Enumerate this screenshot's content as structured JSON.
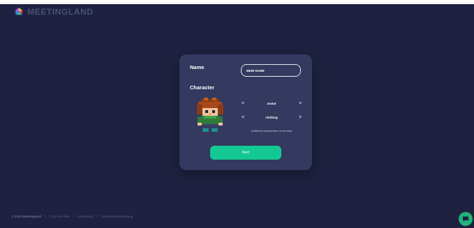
{
  "brand": {
    "name": "MEETINGLAND"
  },
  "form": {
    "name_label": "Name",
    "name_value": "MEIN NAME",
    "character_label": "Character",
    "selectors": [
      {
        "label": "avatar",
        "prev": "<",
        "next": ">"
      },
      {
        "label": "clothing",
        "prev": "<",
        "next": ">"
      }
    ],
    "note": "Additional customization on the way!",
    "next_button": "Next"
  },
  "footer": {
    "copyright": "© 2021 Meetingland",
    "separator": "|",
    "links": [
      "FAQ und Hilfe",
      "Impressum",
      "Datenschutzerklärung"
    ]
  },
  "colors": {
    "background": "#1e2240",
    "card": "#33395f",
    "accent": "#13c893",
    "chat": "#20b478"
  },
  "icons": {
    "logo": "meetingland-logo-icon",
    "chat": "chat-bubble-icon"
  }
}
